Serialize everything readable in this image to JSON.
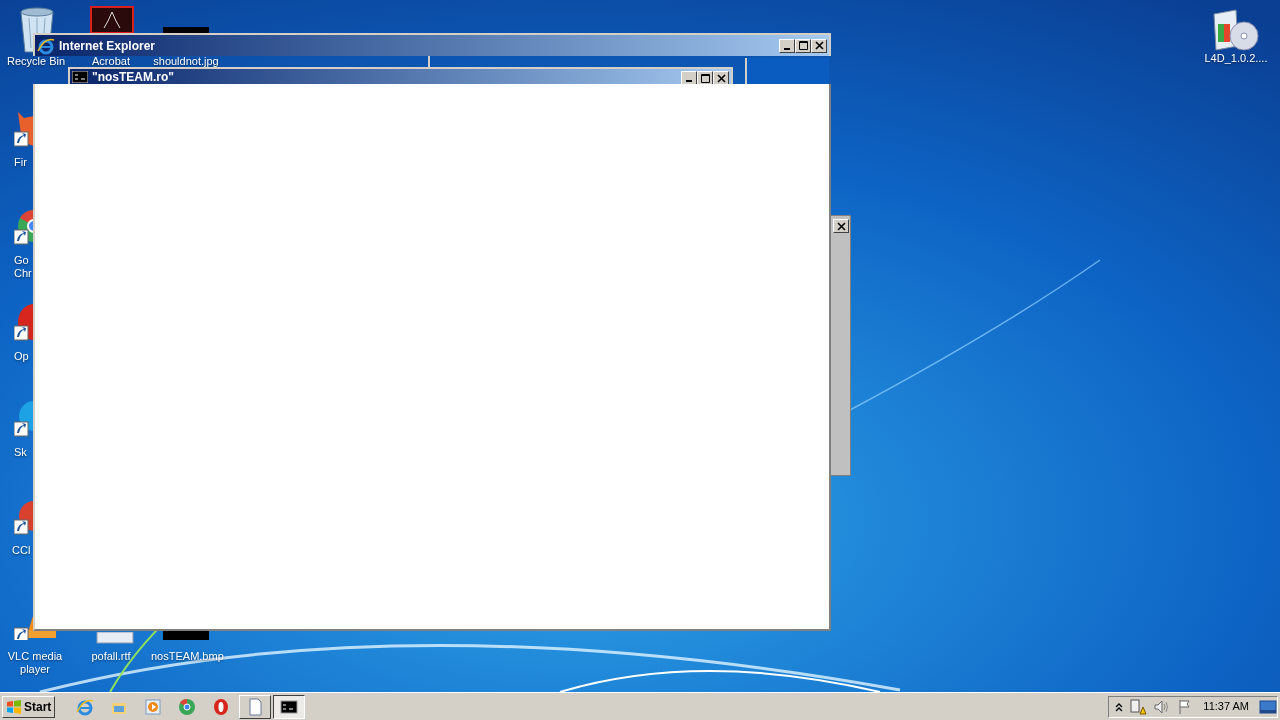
{
  "desktop_icons": [
    {
      "kind": "recycle-bin",
      "label": "Recycle Bin"
    },
    {
      "kind": "pdf",
      "label": "Acrobat"
    },
    {
      "kind": "image",
      "label": "shouldnot.jpg"
    },
    {
      "kind": "installer",
      "label": "L4D_1.0.2...."
    },
    {
      "kind": "firefox",
      "label": "Fir"
    },
    {
      "kind": "chrome",
      "label": "Go\nChr"
    },
    {
      "kind": "opera",
      "label": "Op"
    },
    {
      "kind": "skype",
      "label": "Sk"
    },
    {
      "kind": "ccleaner",
      "label": "CCl"
    },
    {
      "kind": "vlc",
      "label": "VLC media\nplayer"
    },
    {
      "kind": "document",
      "label": "pofall.rtf"
    },
    {
      "kind": "image",
      "label": "nosTEAM.bmp"
    }
  ],
  "windows": [
    {
      "kind": "back"
    },
    {
      "kind": "browser",
      "title": "Internet Explorer"
    },
    {
      "kind": "console",
      "title": "\"nosTEAM.ro\""
    }
  ],
  "taskbar": {
    "start": "Start",
    "items": [
      {
        "kind": "ie",
        "active": false
      },
      {
        "kind": "explorer",
        "active": false
      },
      {
        "kind": "media",
        "active": false
      },
      {
        "kind": "chrome",
        "active": false
      },
      {
        "kind": "opera",
        "active": false
      },
      {
        "kind": "document",
        "active": false
      },
      {
        "kind": "console",
        "active": true
      }
    ],
    "tray": {
      "clock": "11:37 AM"
    }
  }
}
